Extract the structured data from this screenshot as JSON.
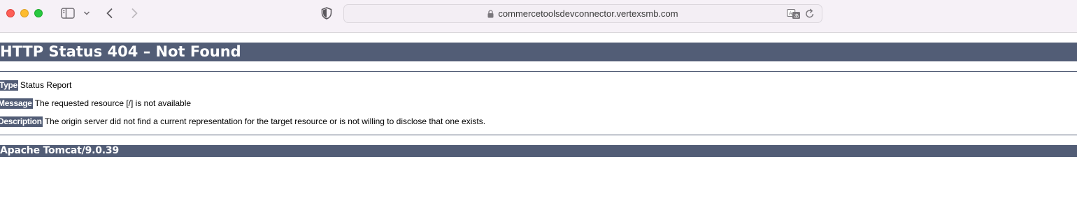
{
  "browser": {
    "url": "commercetoolsdevconnector.vertexsmb.com",
    "icons": {
      "sidebar": "sidebar-icon",
      "chevron": "chevron-down-icon",
      "back": "chevron-left-icon",
      "forward": "chevron-right-icon",
      "privacy": "shield-icon",
      "lock": "lock-icon",
      "translate": "translate-icon",
      "reload": "reload-icon"
    },
    "colors": {
      "toolbar_bg": "#f6f1f7",
      "close": "#fe5f57",
      "minimize": "#febc2e",
      "zoom": "#28c840"
    }
  },
  "page": {
    "heading": "HTTP Status 404 – Not Found",
    "type_label": "Type",
    "type_value": "Status Report",
    "message_label": "Message",
    "message_value": "The requested resource [/] is not available",
    "description_label": "Description",
    "description_value": "The origin server did not find a current representation for the target resource or is not willing to disclose that one exists.",
    "server": "Apache Tomcat/9.0.39",
    "colors": {
      "banner": "#525d76",
      "banner_text": "#ffffff"
    }
  }
}
